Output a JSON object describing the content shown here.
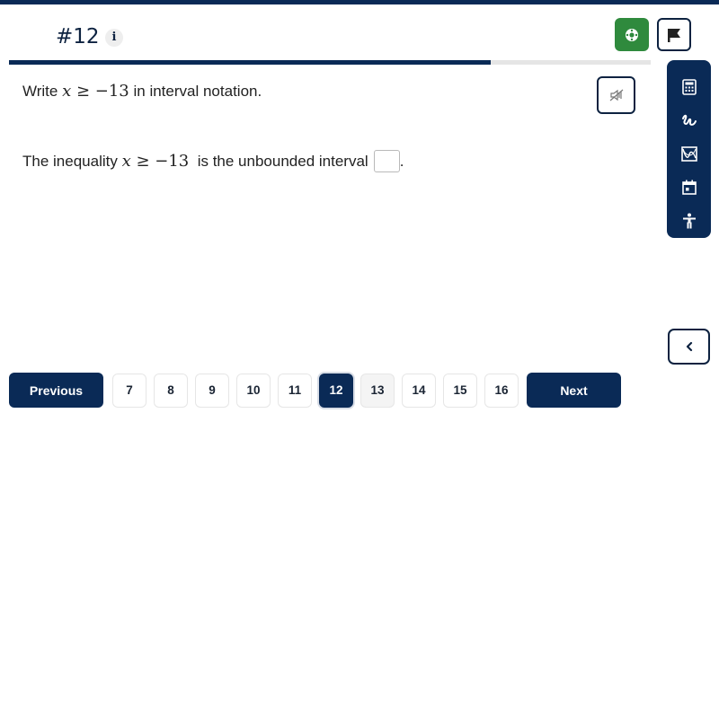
{
  "header": {
    "question_number": "#12",
    "info_label": "i",
    "progress_fraction": 0.75
  },
  "colors": {
    "primary": "#0a2a56",
    "accent_green": "#2f8a3d",
    "progress_track": "#e5e5e5"
  },
  "actions": {
    "green_button_icon": "lifebuoy-icon",
    "flag_button_icon": "flag-icon",
    "audio_button_icon": "audio-muted-icon"
  },
  "toolbox": {
    "tools": [
      {
        "name": "calculator",
        "icon": "calculator-icon"
      },
      {
        "name": "scratchpad",
        "icon": "scribble-icon"
      },
      {
        "name": "graph",
        "icon": "graph-icon"
      },
      {
        "name": "calendar",
        "icon": "calendar-icon"
      },
      {
        "name": "accessibility",
        "icon": "accessibility-icon"
      }
    ],
    "collapse_icon": "chevron-left-icon"
  },
  "question": {
    "prompt_prefix": "Write",
    "prompt_var": "x",
    "prompt_relation": " ≥ −13",
    "prompt_suffix": "in interval notation.",
    "statement_prefix": "The inequality",
    "statement_var": "x",
    "statement_relation": " ≥ −13",
    "statement_suffix": "is the unbounded interval",
    "statement_end": ".",
    "answer_value": ""
  },
  "pagination": {
    "previous_label": "Previous",
    "next_label": "Next",
    "pages": [
      "7",
      "8",
      "9",
      "10",
      "11",
      "12",
      "13",
      "14",
      "15",
      "16"
    ],
    "current_page": "12"
  }
}
